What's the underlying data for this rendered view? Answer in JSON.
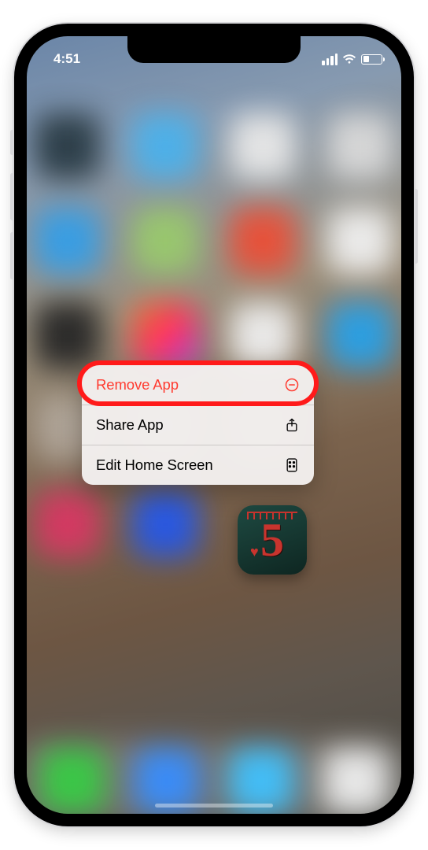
{
  "status_bar": {
    "time": "4:51"
  },
  "context_menu": {
    "items": [
      {
        "label": "Remove App",
        "icon": "circle-minus",
        "destructive": true,
        "highlighted": true
      },
      {
        "label": "Share App",
        "icon": "share",
        "destructive": false,
        "highlighted": false
      },
      {
        "label": "Edit Home Screen",
        "icon": "apps",
        "destructive": false,
        "highlighted": false
      }
    ]
  },
  "focused_app": {
    "glyph": "5"
  }
}
